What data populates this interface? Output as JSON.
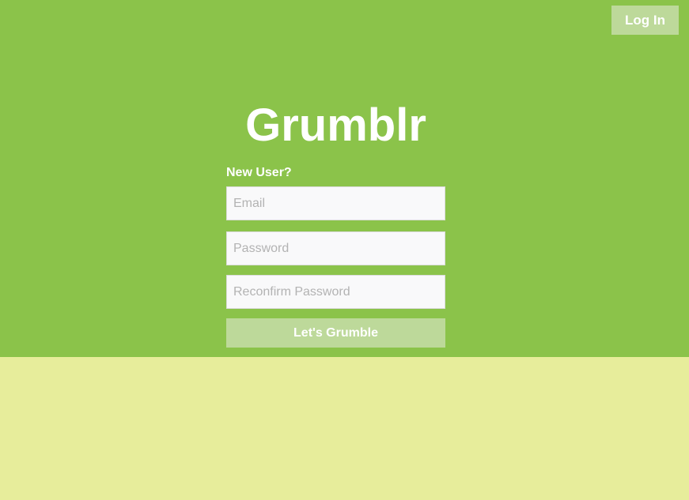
{
  "header": {
    "login_label": "Log In"
  },
  "brand": {
    "title": "Grumblr"
  },
  "signup": {
    "heading": "New User?",
    "email_placeholder": "Email",
    "email_value": "",
    "password_placeholder": "Password",
    "password_value": "",
    "reconfirm_placeholder": "Reconfirm Password",
    "reconfirm_value": "",
    "submit_label": "Let's Grumble"
  },
  "colors": {
    "hero_background": "#8bc34a",
    "page_background": "#e7ed9b",
    "button_background": "#bdd99a",
    "text": "#ffffff"
  }
}
